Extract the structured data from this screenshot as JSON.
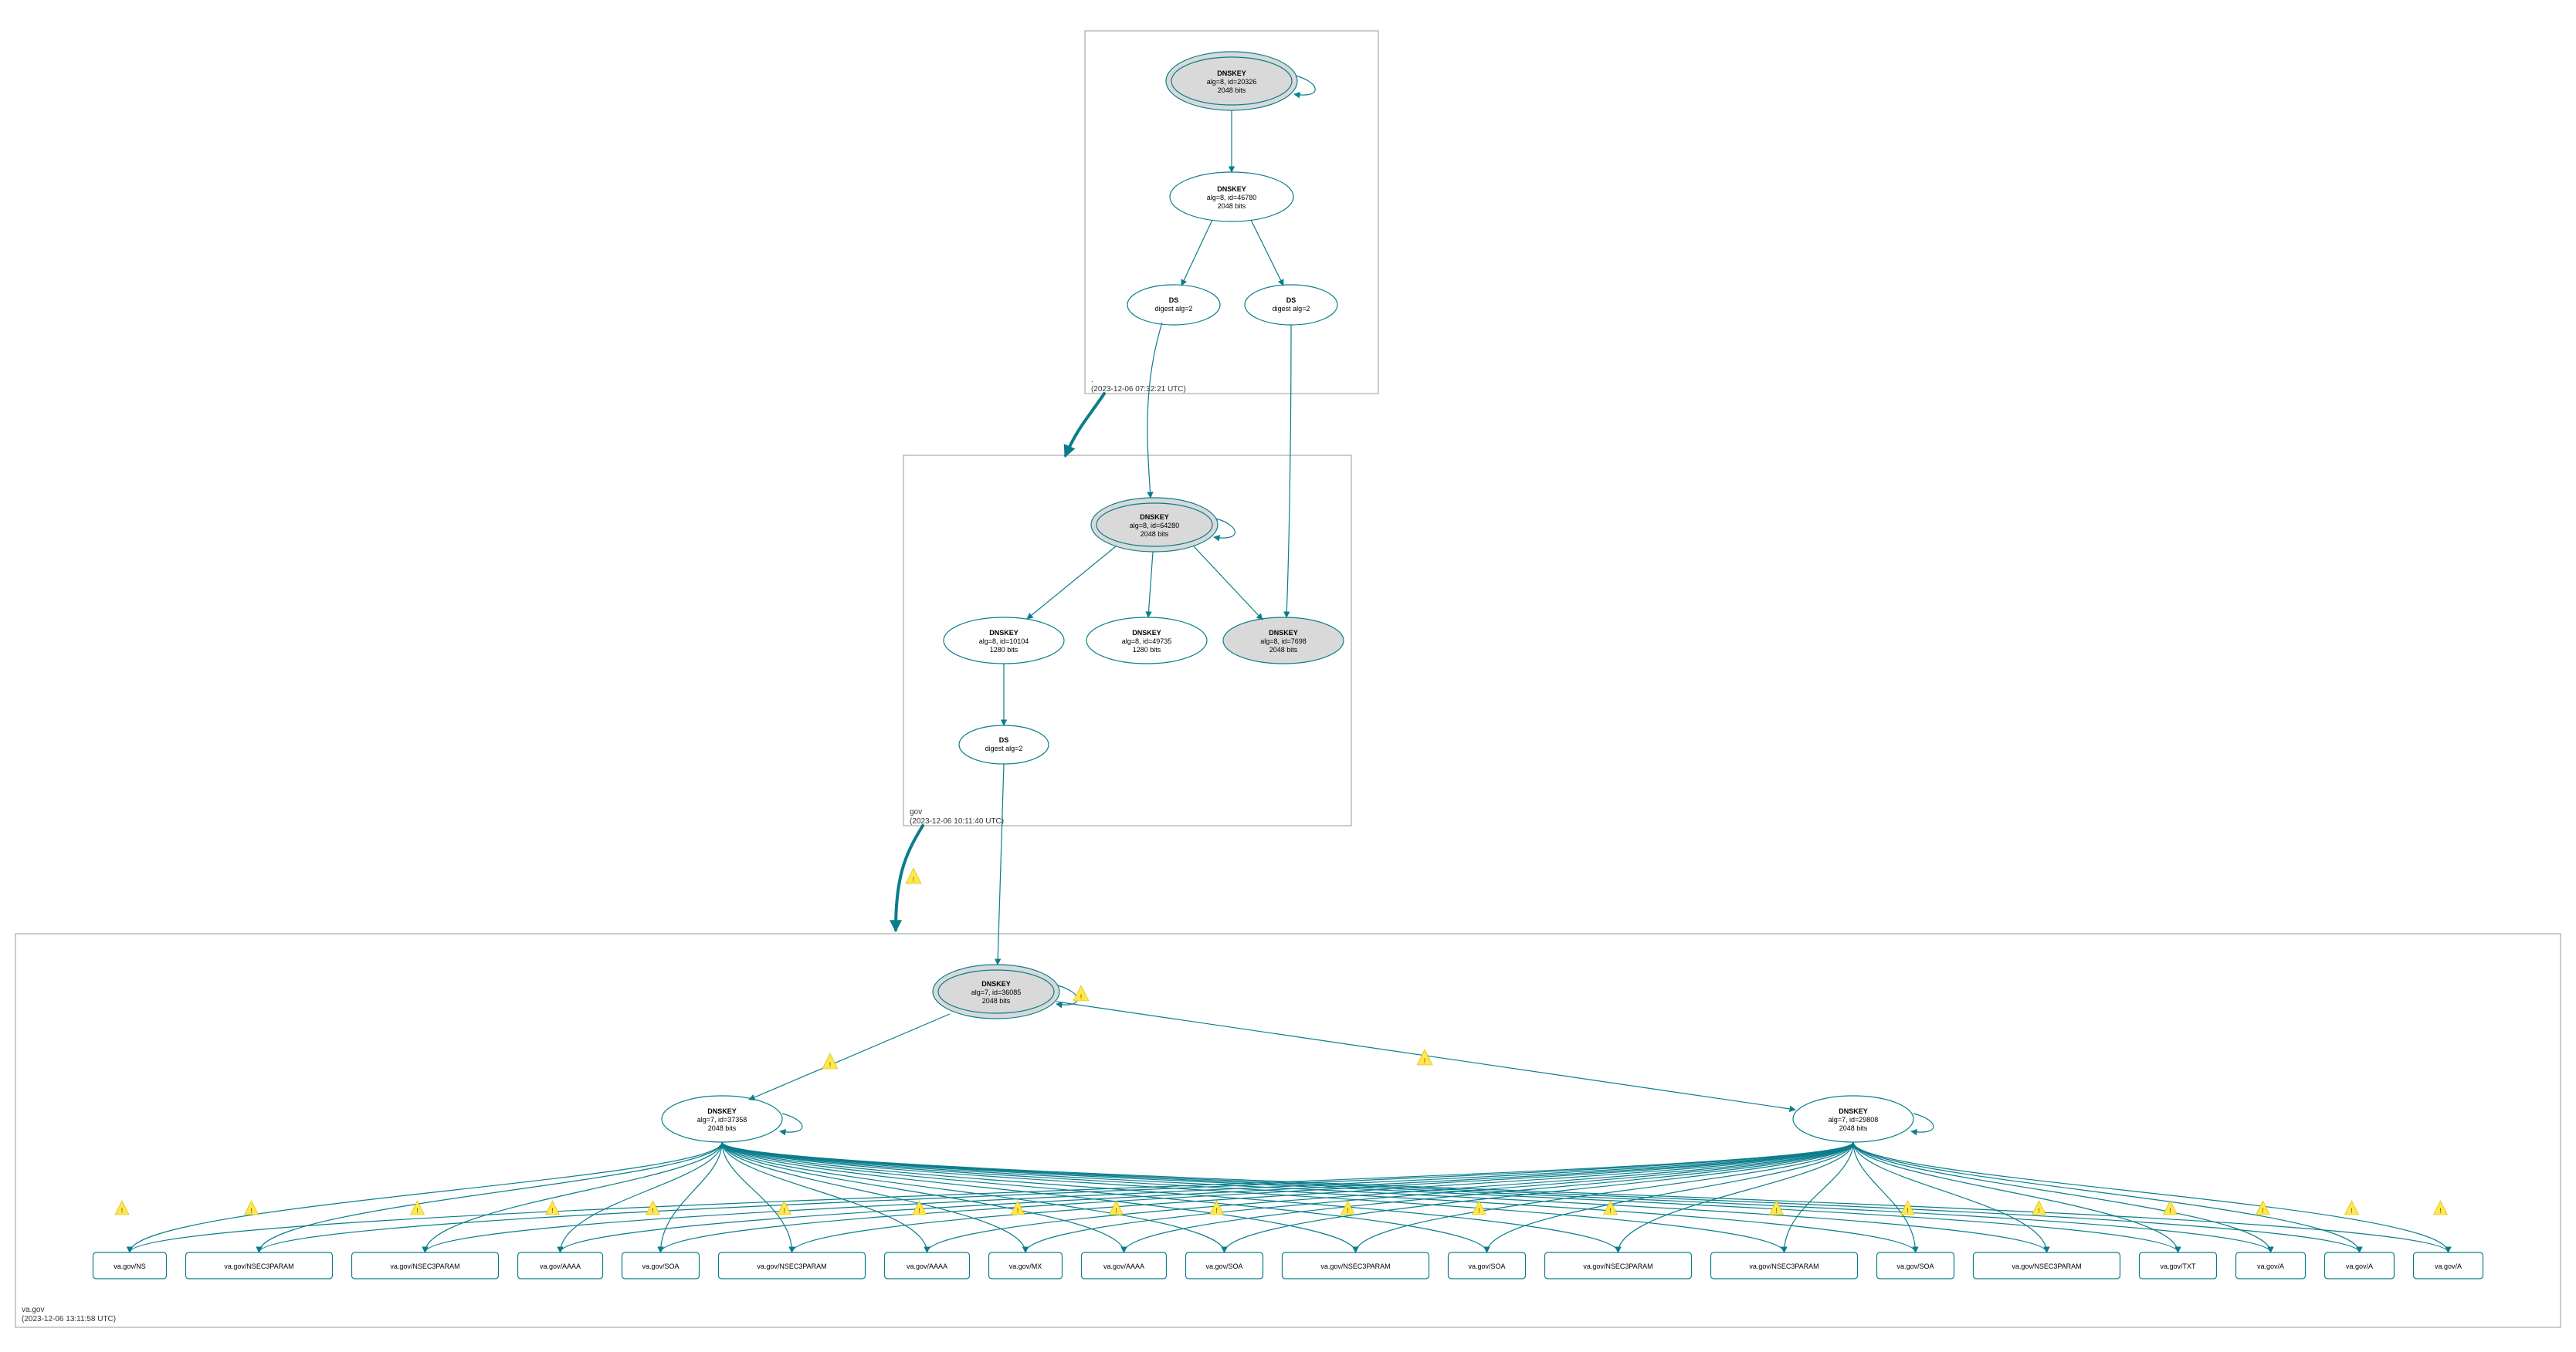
{
  "colors": {
    "edge": "#0a7d8c"
  },
  "zones": {
    "root": {
      "label": ".",
      "timestamp": "(2023-12-06 07:32:21 UTC)"
    },
    "gov": {
      "label": "gov",
      "timestamp": "(2023-12-06 10:11:40 UTC)"
    },
    "vagov": {
      "label": "va.gov",
      "timestamp": "(2023-12-06 13:11:58 UTC)"
    }
  },
  "root_nodes": {
    "ksk": {
      "title": "DNSKEY",
      "sub1": "alg=8, id=20326",
      "sub2": "2048 bits"
    },
    "zsk": {
      "title": "DNSKEY",
      "sub1": "alg=8, id=46780",
      "sub2": "2048 bits"
    },
    "ds1": {
      "title": "DS",
      "sub1": "digest alg=2"
    },
    "ds2": {
      "title": "DS",
      "sub1": "digest alg=2"
    }
  },
  "gov_nodes": {
    "ksk": {
      "title": "DNSKEY",
      "sub1": "alg=8, id=64280",
      "sub2": "2048 bits"
    },
    "zsk1": {
      "title": "DNSKEY",
      "sub1": "alg=8, id=10104",
      "sub2": "1280 bits"
    },
    "zsk2": {
      "title": "DNSKEY",
      "sub1": "alg=8, id=49735",
      "sub2": "1280 bits"
    },
    "zsk3": {
      "title": "DNSKEY",
      "sub1": "alg=8, id=7698",
      "sub2": "2048 bits"
    },
    "ds": {
      "title": "DS",
      "sub1": "digest alg=2"
    }
  },
  "vagov_nodes": {
    "ksk": {
      "title": "DNSKEY",
      "sub1": "alg=7, id=36085",
      "sub2": "2048 bits"
    },
    "zsk1": {
      "title": "DNSKEY",
      "sub1": "alg=7, id=37358",
      "sub2": "2048 bits"
    },
    "zsk2": {
      "title": "DNSKEY",
      "sub1": "alg=7, id=29808",
      "sub2": "2048 bits"
    }
  },
  "rrsets": [
    "va.gov/NS",
    "va.gov/NSEC3PARAM",
    "va.gov/NSEC3PARAM",
    "va.gov/AAAA",
    "va.gov/SOA",
    "va.gov/NSEC3PARAM",
    "va.gov/AAAA",
    "va.gov/MX",
    "va.gov/AAAA",
    "va.gov/SOA",
    "va.gov/NSEC3PARAM",
    "va.gov/SOA",
    "va.gov/NSEC3PARAM",
    "va.gov/NSEC3PARAM",
    "va.gov/SOA",
    "va.gov/NSEC3PARAM",
    "va.gov/TXT",
    "va.gov/A",
    "va.gov/A",
    "va.gov/A"
  ]
}
